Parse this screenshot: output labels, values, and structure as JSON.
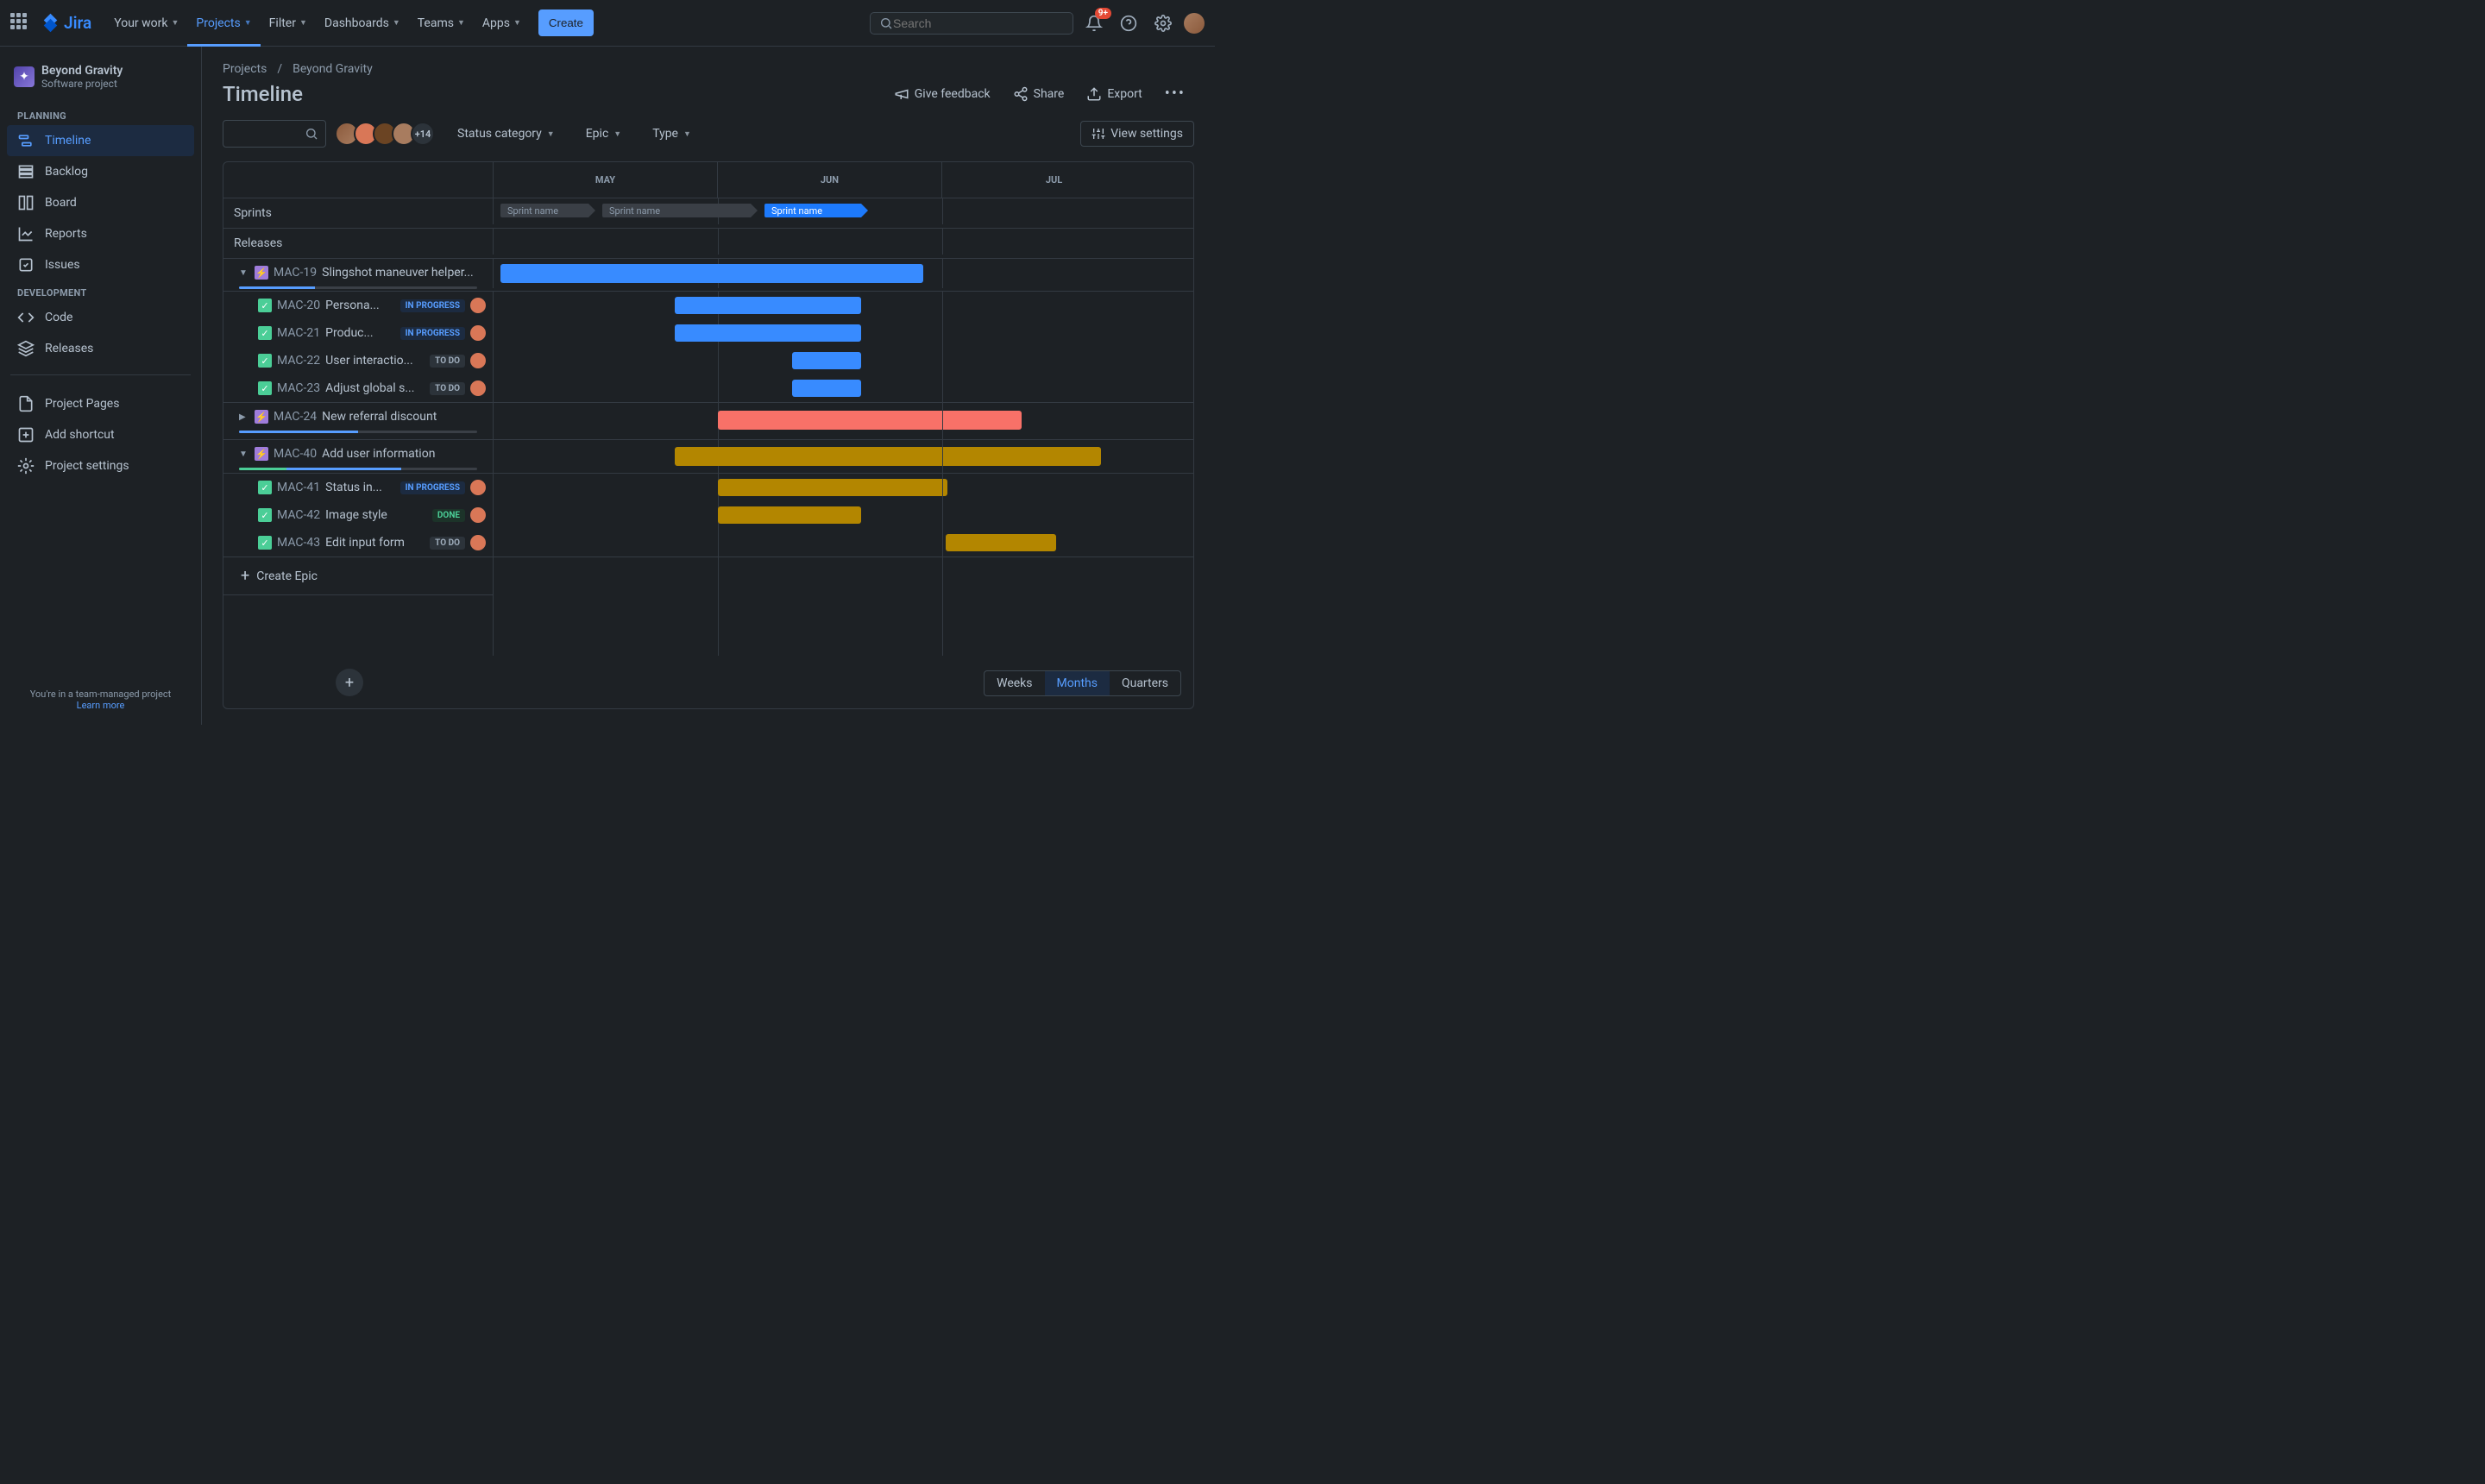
{
  "nav": {
    "yourWork": "Your work",
    "projects": "Projects",
    "filter": "Filter",
    "dashboards": "Dashboards",
    "teams": "Teams",
    "apps": "Apps",
    "create": "Create",
    "searchPlaceholder": "Search",
    "notifBadge": "9+",
    "logoText": "Jira"
  },
  "project": {
    "name": "Beyond Gravity",
    "type": "Software project"
  },
  "sidebar": {
    "planning": "PLANNING",
    "development": "DEVELOPMENT",
    "items": {
      "timeline": "Timeline",
      "backlog": "Backlog",
      "board": "Board",
      "reports": "Reports",
      "issues": "Issues",
      "code": "Code",
      "releases": "Releases",
      "projectPages": "Project Pages",
      "addShortcut": "Add shortcut",
      "projectSettings": "Project settings"
    },
    "footer": "You're in a team-managed project",
    "learnMore": "Learn more"
  },
  "breadcrumb": {
    "projects": "Projects",
    "project": "Beyond Gravity"
  },
  "page": {
    "title": "Timeline"
  },
  "actions": {
    "feedback": "Give feedback",
    "share": "Share",
    "export": "Export",
    "viewSettings": "View settings",
    "avatarOverflow": "+14"
  },
  "filters": {
    "statusCategory": "Status category",
    "epic": "Epic",
    "type": "Type"
  },
  "timeline": {
    "months": [
      "MAY",
      "JUN",
      "JUL"
    ],
    "sprintsLabel": "Sprints",
    "releasesLabel": "Releases",
    "sprintName": "Sprint name",
    "createEpic": "Create Epic",
    "statuses": {
      "todo": "TO DO",
      "inProgress": "IN PROGRESS",
      "done": "DONE"
    }
  },
  "issues": {
    "e1": {
      "key": "MAC-19",
      "title": "Slingshot maneuver helper..."
    },
    "e1c": [
      {
        "key": "MAC-20",
        "title": "Persona..."
      },
      {
        "key": "MAC-21",
        "title": "Produc..."
      },
      {
        "key": "MAC-22",
        "title": "User interactio..."
      },
      {
        "key": "MAC-23",
        "title": "Adjust global s..."
      }
    ],
    "e2": {
      "key": "MAC-24",
      "title": "New referral discount"
    },
    "e3": {
      "key": "MAC-40",
      "title": "Add user information"
    },
    "e3c": [
      {
        "key": "MAC-41",
        "title": "Status in..."
      },
      {
        "key": "MAC-42",
        "title": "Image style"
      },
      {
        "key": "MAC-43",
        "title": "Edit input form"
      }
    ]
  },
  "zoom": {
    "weeks": "Weeks",
    "months": "Months",
    "quarters": "Quarters"
  }
}
